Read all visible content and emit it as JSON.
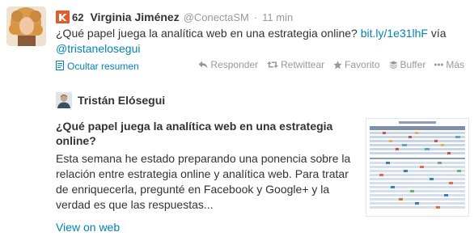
{
  "tweet": {
    "klout_score": "62",
    "fullname": "Virginia Jiménez",
    "username": "@ConectaSM",
    "separator": "·",
    "time": "11 min",
    "text_main": "¿Qué papel juega la analítica web en una estrategia online?",
    "link": "bit.ly/1e31lhF",
    "via": "vía",
    "mention": "@tristanelosegui"
  },
  "actions": {
    "collapse": "Ocultar resumen",
    "reply": "Responder",
    "retweet": "Retwittear",
    "favorite": "Favorito",
    "buffer": "Buffer",
    "more": "Más"
  },
  "card": {
    "author": "Tristán Elósegui",
    "title": "¿Qué papel juega la analítica web en una estrategia online?",
    "description": "Esta semana he estado preparando una ponencia sobre la relación entre estrategia online y analítica web. Para tratar de enriquecerla, pregunté en Facebook y Google+ y la verdad es que las respuestas...",
    "view_on_web": "View on web"
  },
  "colors": {
    "link": "#0084b4",
    "muted": "#999999",
    "klout": "#e25b2b"
  }
}
